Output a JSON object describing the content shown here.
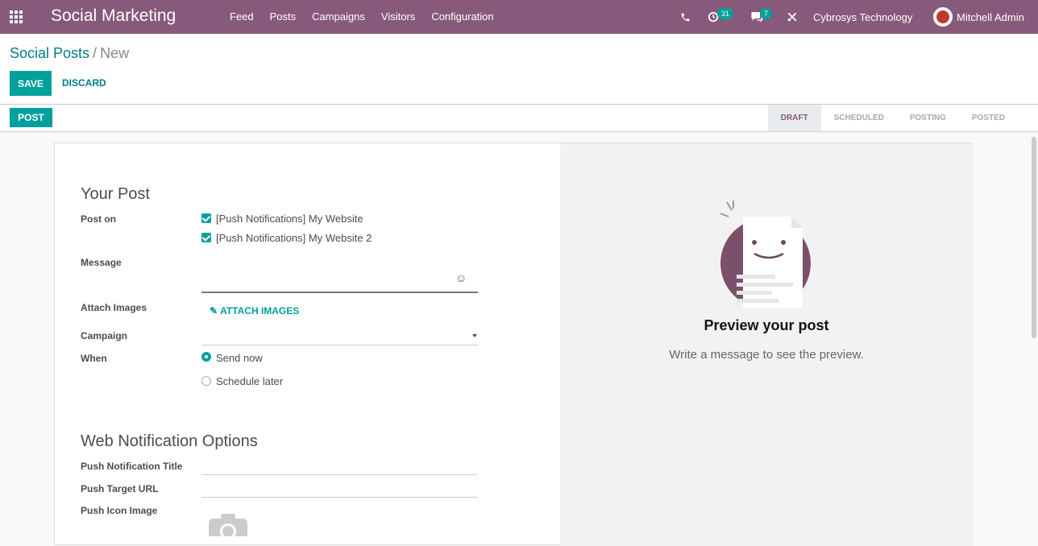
{
  "topbar": {
    "app_title": "Social Marketing",
    "menu": [
      "Feed",
      "Posts",
      "Campaigns",
      "Visitors",
      "Configuration"
    ],
    "activity_count": "31",
    "message_count": "7",
    "company": "Cybrosys Technology",
    "user": "Mitchell Admin"
  },
  "breadcrumb": {
    "parent": "Social Posts",
    "separator": "/",
    "current": "New"
  },
  "buttons": {
    "save": "SAVE",
    "discard": "DISCARD",
    "post": "POST"
  },
  "stages": [
    "DRAFT",
    "SCHEDULED",
    "POSTING",
    "POSTED"
  ],
  "form": {
    "section_post": "Your Post",
    "post_on_label": "Post on",
    "accounts": [
      "[Push Notifications] My Website",
      "[Push Notifications] My Website 2"
    ],
    "message_label": "Message",
    "attach_label": "Attach Images",
    "attach_button": "ATTACH IMAGES",
    "campaign_label": "Campaign",
    "when_label": "When",
    "when_options": [
      "Send now",
      "Schedule later"
    ],
    "section_web": "Web Notification Options",
    "push_title_label": "Push Notification Title",
    "push_url_label": "Push Target URL",
    "push_icon_label": "Push Icon Image"
  },
  "preview": {
    "title": "Preview your post",
    "subtitle": "Write a message to see the preview."
  },
  "colors": {
    "brand": "#875a7b",
    "accent": "#00a09d"
  }
}
